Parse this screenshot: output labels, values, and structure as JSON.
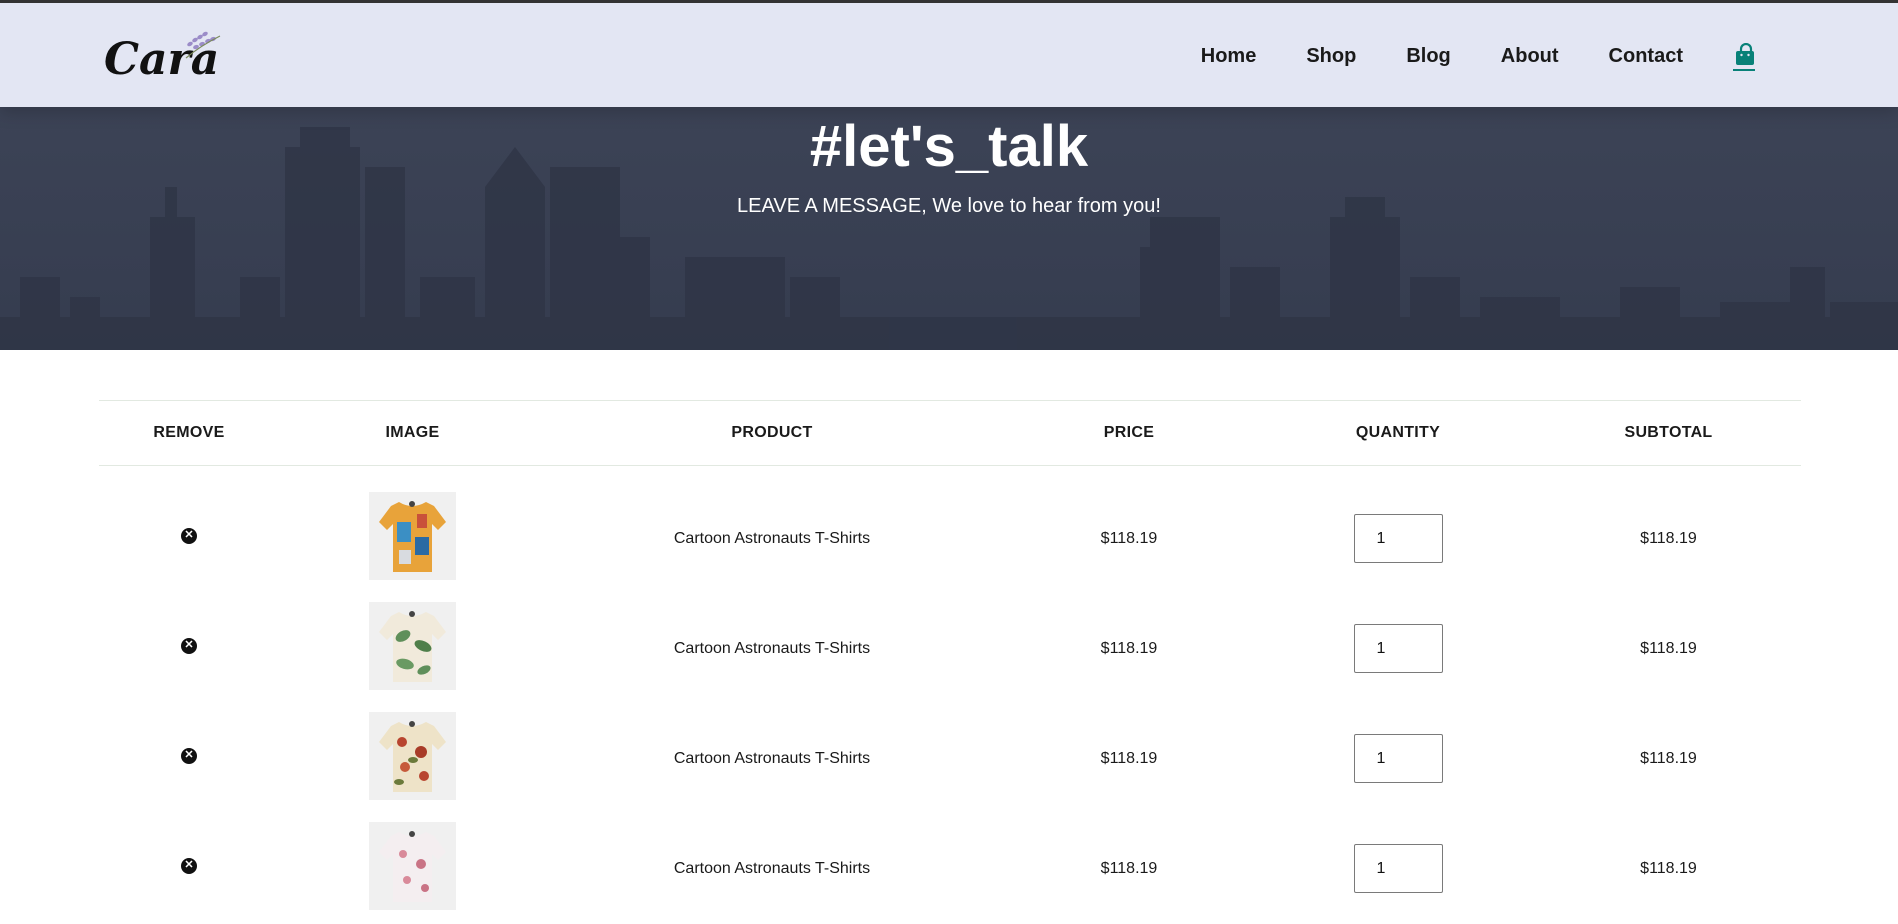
{
  "header": {
    "logo_text": "Cara",
    "nav": [
      "Home",
      "Shop",
      "Blog",
      "About",
      "Contact"
    ],
    "cart_icon": "shopping-bag-icon",
    "accent_color": "#088178"
  },
  "hero": {
    "title": "#let's_talk",
    "subtitle": "LEAVE A MESSAGE, We love to hear from you!"
  },
  "cart": {
    "columns": [
      "REMOVE",
      "IMAGE",
      "PRODUCT",
      "PRICE",
      "QUANTITY",
      "SUBTOTAL"
    ],
    "rows": [
      {
        "image": "shirt-astronaut-print",
        "product": "Cartoon Astronauts T-Shirts",
        "price": "$118.19",
        "quantity": "1",
        "subtotal": "$118.19"
      },
      {
        "image": "shirt-green-leaf-print",
        "product": "Cartoon Astronauts T-Shirts",
        "price": "$118.19",
        "quantity": "1",
        "subtotal": "$118.19"
      },
      {
        "image": "shirt-red-floral-print",
        "product": "Cartoon Astronauts T-Shirts",
        "price": "$118.19",
        "quantity": "1",
        "subtotal": "$118.19"
      },
      {
        "image": "shirt-pink-floral-print",
        "product": "Cartoon Astronauts T-Shirts",
        "price": "$118.19",
        "quantity": "1",
        "subtotal": "$118.19"
      }
    ]
  }
}
